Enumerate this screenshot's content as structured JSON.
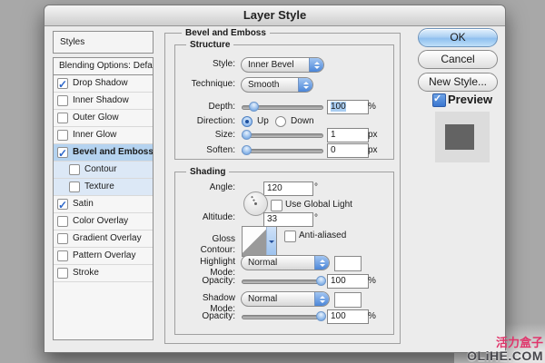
{
  "window": {
    "title": "Layer Style"
  },
  "sidebar": {
    "header": "Styles",
    "items": [
      {
        "label": "Blending Options: Default",
        "checkbox": false,
        "checked": false
      },
      {
        "label": "Drop Shadow",
        "checkbox": true,
        "checked": true
      },
      {
        "label": "Inner Shadow",
        "checkbox": true,
        "checked": false
      },
      {
        "label": "Outer Glow",
        "checkbox": true,
        "checked": false
      },
      {
        "label": "Inner Glow",
        "checkbox": true,
        "checked": false
      },
      {
        "label": "Bevel and Emboss",
        "checkbox": true,
        "checked": true,
        "selected": true
      },
      {
        "label": "Contour",
        "checkbox": true,
        "checked": false,
        "indented": true
      },
      {
        "label": "Texture",
        "checkbox": true,
        "checked": false,
        "indented": true
      },
      {
        "label": "Satin",
        "checkbox": true,
        "checked": true
      },
      {
        "label": "Color Overlay",
        "checkbox": true,
        "checked": false
      },
      {
        "label": "Gradient Overlay",
        "checkbox": true,
        "checked": false
      },
      {
        "label": "Pattern Overlay",
        "checkbox": true,
        "checked": false
      },
      {
        "label": "Stroke",
        "checkbox": true,
        "checked": false
      }
    ]
  },
  "panel": {
    "group_title": "Bevel and Emboss",
    "structure": {
      "title": "Structure",
      "style_label": "Style:",
      "style_value": "Inner Bevel",
      "technique_label": "Technique:",
      "technique_value": "Smooth",
      "depth_label": "Depth:",
      "depth_value": "100",
      "depth_unit": "%",
      "direction_label": "Direction:",
      "direction_up": "Up",
      "direction_down": "Down",
      "direction_selected": "Up",
      "size_label": "Size:",
      "size_value": "1",
      "size_unit": "px",
      "soften_label": "Soften:",
      "soften_value": "0",
      "soften_unit": "px"
    },
    "shading": {
      "title": "Shading",
      "angle_label": "Angle:",
      "angle_value": "120",
      "angle_unit": "°",
      "use_global_light_label": "Use Global Light",
      "use_global_light_checked": false,
      "altitude_label": "Altitude:",
      "altitude_value": "33",
      "altitude_unit": "°",
      "gloss_contour_label": "Gloss Contour:",
      "anti_aliased_label": "Anti-aliased",
      "anti_aliased_checked": false,
      "highlight_mode_label": "Highlight Mode:",
      "highlight_mode_value": "Normal",
      "highlight_opacity_label": "Opacity:",
      "highlight_opacity_value": "100",
      "highlight_opacity_unit": "%",
      "shadow_mode_label": "Shadow Mode:",
      "shadow_mode_value": "Normal",
      "shadow_opacity_label": "Opacity:",
      "shadow_opacity_value": "100",
      "shadow_opacity_unit": "%"
    }
  },
  "actions": {
    "ok": "OK",
    "cancel": "Cancel",
    "new_style": "New Style...",
    "preview_label": "Preview",
    "preview_checked": true
  },
  "colors": {
    "accent_blue": "#3a76cf",
    "selected_row": "#b5d3f0",
    "selection_highlight": "#a9cdf2",
    "watermark_red": "#e0356b"
  },
  "watermark": {
    "line1": "活力盒子",
    "line2": "OLiHE.COM"
  }
}
